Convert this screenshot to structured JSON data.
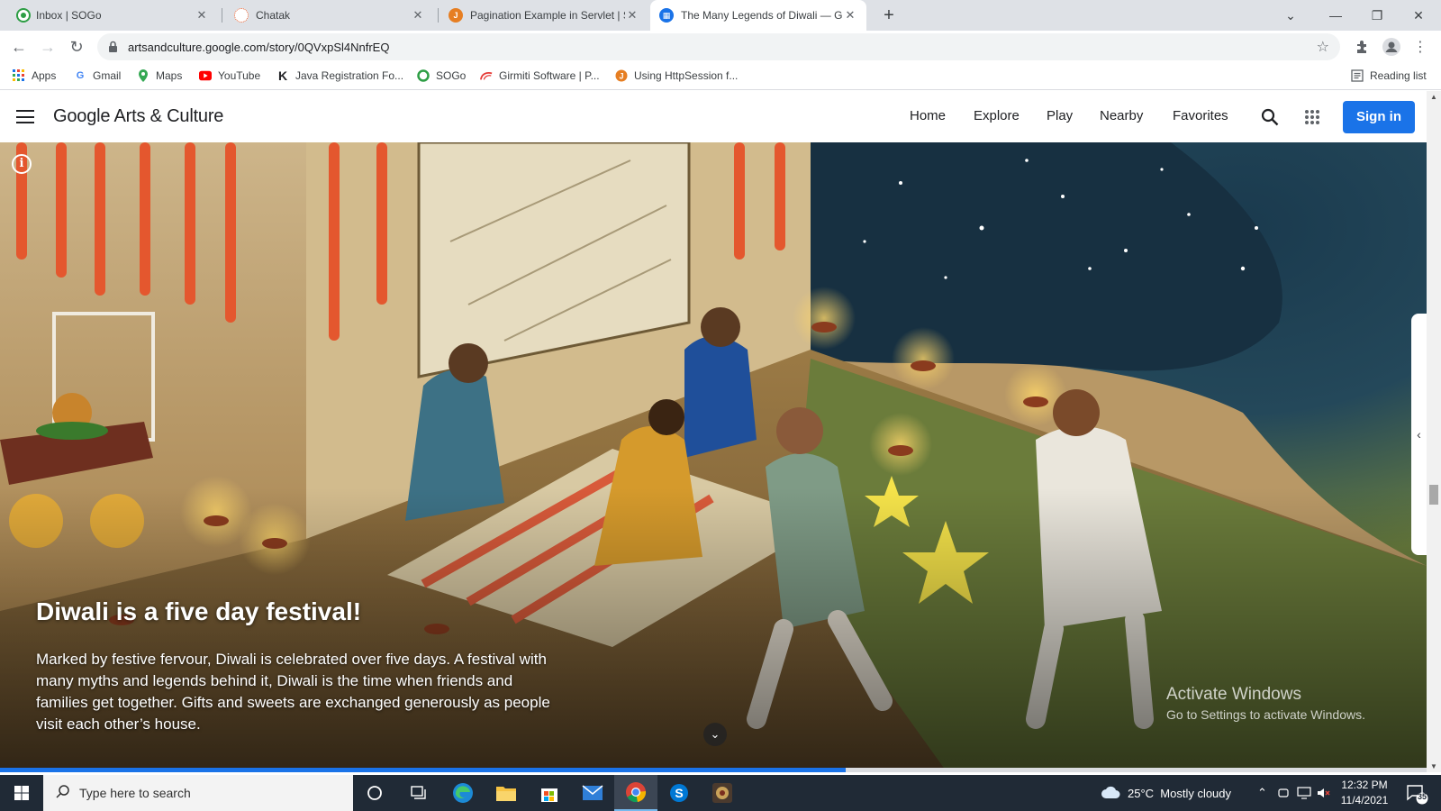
{
  "browser": {
    "tabs": [
      {
        "title": "Inbox | SOGo",
        "favicon": "sogo-icon",
        "color": "#2e9e45",
        "active": false
      },
      {
        "title": "Chatak",
        "favicon": "chatak-icon",
        "color": "#e55b2b",
        "active": false
      },
      {
        "title": "Pagination Example in Servlet | St",
        "favicon": "javatpoint-icon",
        "color": "#e67e22",
        "active": false
      },
      {
        "title": "The Many Legends of Diwali — G",
        "favicon": "arts-culture-icon",
        "color": "#1a73e8",
        "active": true
      }
    ],
    "url": "artsandculture.google.com/story/0QVxpSl4NnfrEQ",
    "bookmarks": [
      {
        "label": "Apps",
        "icon": "apps-grid-icon"
      },
      {
        "label": "Gmail",
        "icon": "google-icon"
      },
      {
        "label": "Maps",
        "icon": "maps-icon"
      },
      {
        "label": "YouTube",
        "icon": "youtube-icon"
      },
      {
        "label": "Java Registration Fo...",
        "icon": "k-icon"
      },
      {
        "label": "SOGo",
        "icon": "sogo-icon"
      },
      {
        "label": "Girmiti Software | P...",
        "icon": "girmiti-icon"
      },
      {
        "label": "Using HttpSession f...",
        "icon": "javatpoint-icon"
      }
    ],
    "reading_list": "Reading list"
  },
  "site": {
    "brand": "Google Arts & Culture",
    "nav": [
      "Home",
      "Explore",
      "Play",
      "Nearby",
      "Favorites"
    ],
    "signin": "Sign in"
  },
  "hero": {
    "title": "Diwali is a five day festival!",
    "body": "Marked by festive fervour, Diwali is celebrated over five days. A festival with many myths and legends behind it, Diwali is the time when friends and families get together. Gifts and sweets are exchanged generously as people visit each other’s house.",
    "progress_fraction": 0.593
  },
  "watermark": {
    "line1": "Activate Windows",
    "line2": "Go to Settings to activate Windows."
  },
  "taskbar": {
    "search_placeholder": "Type here to search",
    "weather": "25°C  Mostly cloudy",
    "time": "12:32 PM",
    "date": "11/4/2021",
    "notification_count": "35"
  }
}
